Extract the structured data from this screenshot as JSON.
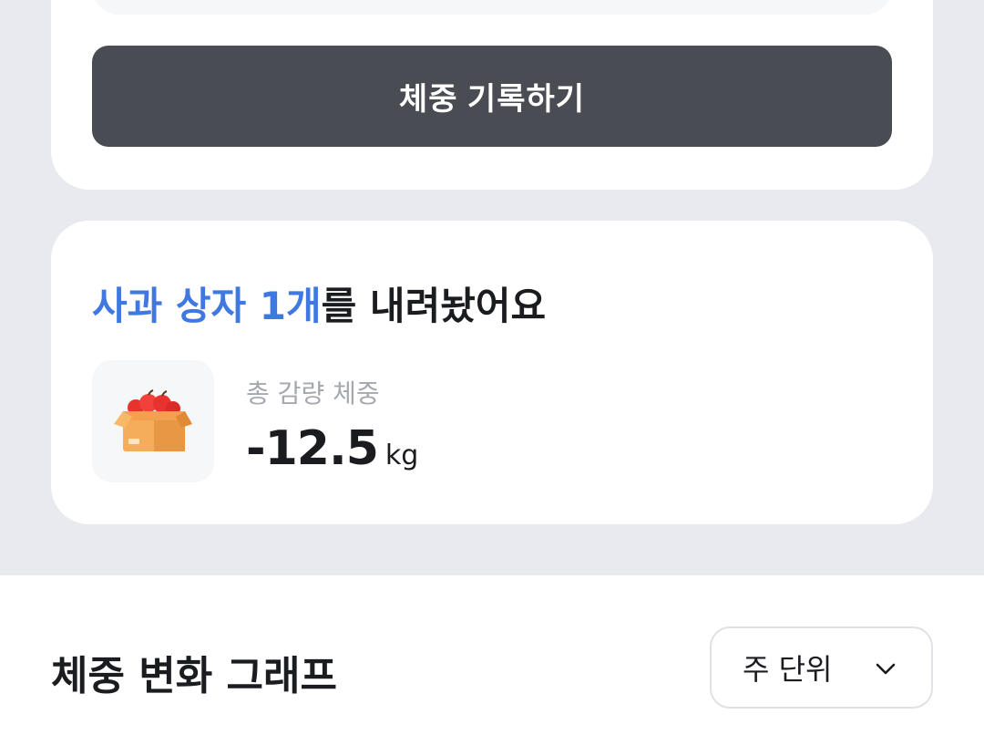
{
  "top_card": {
    "record_button_label": "체중 기록하기"
  },
  "achievement": {
    "title_highlight": "사과 상자 1개",
    "title_rest": "를 내려놨어요",
    "icon": "apple-box-icon",
    "stat_label": "총 감량 체중",
    "stat_value": "-12.5",
    "stat_unit": "kg",
    "highlight_color": "#3f78e0"
  },
  "graph_section": {
    "title": "체중 변화 그래프",
    "period_selected": "주 단위",
    "period_icon": "chevron-down-icon"
  },
  "colors": {
    "background": "#e9eaef",
    "button": "#4a4c54",
    "card": "#ffffff"
  }
}
